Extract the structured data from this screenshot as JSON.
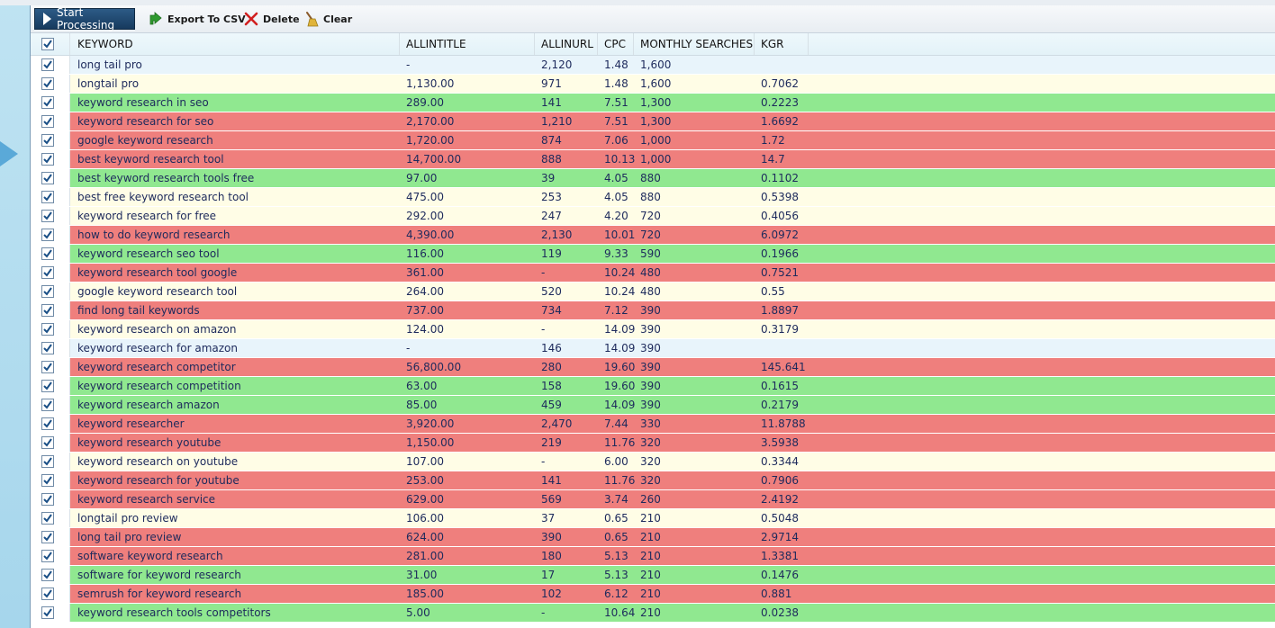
{
  "toolbar": {
    "start_label": "Start Processing",
    "export_label": "Export To CSV",
    "delete_label": "Delete",
    "clear_label": "Clear"
  },
  "columns": {
    "keyword": "KEYWORD",
    "allintitle": "ALLINTITLE",
    "allinurl": "ALLINURL",
    "cpc": "CPC",
    "monthly": "MONTHLY SEARCHES",
    "kgr": "KGR"
  },
  "colors": {
    "green": "#90e890",
    "red": "#ef7f7d",
    "yellow": "#fffde6",
    "blue": "#e8f4fb"
  },
  "rows": [
    {
      "keyword": "long tail pro",
      "allintitle": "-",
      "allinurl": "2,120",
      "cpc": "1.48",
      "monthly": "1,600",
      "kgr": "",
      "status": "blue"
    },
    {
      "keyword": "longtail pro",
      "allintitle": "1,130.00",
      "allinurl": "971",
      "cpc": "1.48",
      "monthly": "1,600",
      "kgr": "0.7062",
      "status": "yellow"
    },
    {
      "keyword": "keyword research in seo",
      "allintitle": "289.00",
      "allinurl": "141",
      "cpc": "7.51",
      "monthly": "1,300",
      "kgr": "0.2223",
      "status": "green"
    },
    {
      "keyword": "keyword research for seo",
      "allintitle": "2,170.00",
      "allinurl": "1,210",
      "cpc": "7.51",
      "monthly": "1,300",
      "kgr": "1.6692",
      "status": "red"
    },
    {
      "keyword": "google keyword research",
      "allintitle": "1,720.00",
      "allinurl": "874",
      "cpc": "7.06",
      "monthly": "1,000",
      "kgr": "1.72",
      "status": "red"
    },
    {
      "keyword": "best keyword research tool",
      "allintitle": "14,700.00",
      "allinurl": "888",
      "cpc": "10.13",
      "monthly": "1,000",
      "kgr": "14.7",
      "status": "red"
    },
    {
      "keyword": "best keyword research tools free",
      "allintitle": "97.00",
      "allinurl": "39",
      "cpc": "4.05",
      "monthly": "880",
      "kgr": "0.1102",
      "status": "green"
    },
    {
      "keyword": "best free keyword research tool",
      "allintitle": "475.00",
      "allinurl": "253",
      "cpc": "4.05",
      "monthly": "880",
      "kgr": "0.5398",
      "status": "yellow"
    },
    {
      "keyword": "keyword research for free",
      "allintitle": "292.00",
      "allinurl": "247",
      "cpc": "4.20",
      "monthly": "720",
      "kgr": "0.4056",
      "status": "yellow"
    },
    {
      "keyword": "how to do keyword research",
      "allintitle": "4,390.00",
      "allinurl": "2,130",
      "cpc": "10.01",
      "monthly": "720",
      "kgr": "6.0972",
      "status": "red"
    },
    {
      "keyword": "keyword research seo tool",
      "allintitle": "116.00",
      "allinurl": "119",
      "cpc": "9.33",
      "monthly": "590",
      "kgr": "0.1966",
      "status": "green"
    },
    {
      "keyword": "keyword research tool google",
      "allintitle": "361.00",
      "allinurl": "-",
      "cpc": "10.24",
      "monthly": "480",
      "kgr": "0.7521",
      "status": "red"
    },
    {
      "keyword": "google keyword research tool",
      "allintitle": "264.00",
      "allinurl": "520",
      "cpc": "10.24",
      "monthly": "480",
      "kgr": "0.55",
      "status": "yellow"
    },
    {
      "keyword": "find long tail keywords",
      "allintitle": "737.00",
      "allinurl": "734",
      "cpc": "7.12",
      "monthly": "390",
      "kgr": "1.8897",
      "status": "red"
    },
    {
      "keyword": "keyword research on amazon",
      "allintitle": "124.00",
      "allinurl": "-",
      "cpc": "14.09",
      "monthly": "390",
      "kgr": "0.3179",
      "status": "yellow"
    },
    {
      "keyword": "keyword research for amazon",
      "allintitle": "-",
      "allinurl": "146",
      "cpc": "14.09",
      "monthly": "390",
      "kgr": "",
      "status": "blue"
    },
    {
      "keyword": "keyword research competitor",
      "allintitle": "56,800.00",
      "allinurl": "280",
      "cpc": "19.60",
      "monthly": "390",
      "kgr": "145.641",
      "status": "red"
    },
    {
      "keyword": "keyword research competition",
      "allintitle": "63.00",
      "allinurl": "158",
      "cpc": "19.60",
      "monthly": "390",
      "kgr": "0.1615",
      "status": "green"
    },
    {
      "keyword": "keyword research amazon",
      "allintitle": "85.00",
      "allinurl": "459",
      "cpc": "14.09",
      "monthly": "390",
      "kgr": "0.2179",
      "status": "green"
    },
    {
      "keyword": "keyword researcher",
      "allintitle": "3,920.00",
      "allinurl": "2,470",
      "cpc": "7.44",
      "monthly": "330",
      "kgr": "11.8788",
      "status": "red"
    },
    {
      "keyword": "keyword research youtube",
      "allintitle": "1,150.00",
      "allinurl": "219",
      "cpc": "11.76",
      "monthly": "320",
      "kgr": "3.5938",
      "status": "red"
    },
    {
      "keyword": "keyword research on youtube",
      "allintitle": "107.00",
      "allinurl": "-",
      "cpc": "6.00",
      "monthly": "320",
      "kgr": "0.3344",
      "status": "yellow"
    },
    {
      "keyword": "keyword research for youtube",
      "allintitle": "253.00",
      "allinurl": "141",
      "cpc": "11.76",
      "monthly": "320",
      "kgr": "0.7906",
      "status": "red"
    },
    {
      "keyword": "keyword research service",
      "allintitle": "629.00",
      "allinurl": "569",
      "cpc": "3.74",
      "monthly": "260",
      "kgr": "2.4192",
      "status": "red"
    },
    {
      "keyword": "longtail pro review",
      "allintitle": "106.00",
      "allinurl": "37",
      "cpc": "0.65",
      "monthly": "210",
      "kgr": "0.5048",
      "status": "yellow"
    },
    {
      "keyword": "long tail pro review",
      "allintitle": "624.00",
      "allinurl": "390",
      "cpc": "0.65",
      "monthly": "210",
      "kgr": "2.9714",
      "status": "red"
    },
    {
      "keyword": "software keyword research",
      "allintitle": "281.00",
      "allinurl": "180",
      "cpc": "5.13",
      "monthly": "210",
      "kgr": "1.3381",
      "status": "red"
    },
    {
      "keyword": "software for keyword research",
      "allintitle": "31.00",
      "allinurl": "17",
      "cpc": "5.13",
      "monthly": "210",
      "kgr": "0.1476",
      "status": "green"
    },
    {
      "keyword": "semrush for keyword research",
      "allintitle": "185.00",
      "allinurl": "102",
      "cpc": "6.12",
      "monthly": "210",
      "kgr": "0.881",
      "status": "red"
    },
    {
      "keyword": "keyword research tools competitors",
      "allintitle": "5.00",
      "allinurl": "-",
      "cpc": "10.64",
      "monthly": "210",
      "kgr": "0.0238",
      "status": "green"
    }
  ]
}
